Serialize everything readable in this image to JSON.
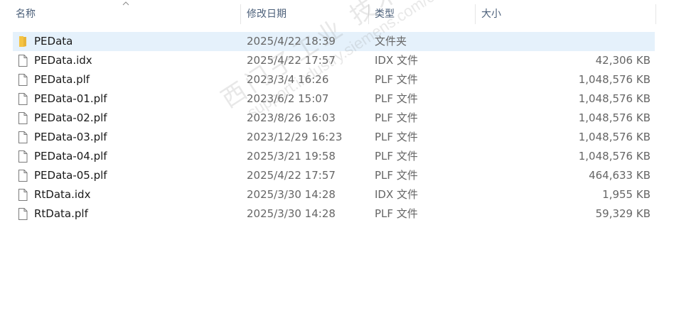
{
  "columns": {
    "name": "名称",
    "date": "修改日期",
    "type": "类型",
    "size": "大小"
  },
  "files": [
    {
      "icon": "folder-icon",
      "name": "PEData",
      "date": "2025/4/22 18:39",
      "type": "文件夹",
      "size": "",
      "selected": true
    },
    {
      "icon": "file-icon",
      "name": "PEData.idx",
      "date": "2025/4/22 17:57",
      "type": "IDX 文件",
      "size": "42,306 KB"
    },
    {
      "icon": "file-icon",
      "name": "PEData.plf",
      "date": "2023/3/4 16:26",
      "type": "PLF 文件",
      "size": "1,048,576 KB"
    },
    {
      "icon": "file-icon",
      "name": "PEData-01.plf",
      "date": "2023/6/2 15:07",
      "type": "PLF 文件",
      "size": "1,048,576 KB"
    },
    {
      "icon": "file-icon",
      "name": "PEData-02.plf",
      "date": "2023/8/26 16:03",
      "type": "PLF 文件",
      "size": "1,048,576 KB"
    },
    {
      "icon": "file-icon",
      "name": "PEData-03.plf",
      "date": "2023/12/29 16:23",
      "type": "PLF 文件",
      "size": "1,048,576 KB"
    },
    {
      "icon": "file-icon",
      "name": "PEData-04.plf",
      "date": "2025/3/21 19:58",
      "type": "PLF 文件",
      "size": "1,048,576 KB"
    },
    {
      "icon": "file-icon",
      "name": "PEData-05.plf",
      "date": "2025/4/22 17:57",
      "type": "PLF 文件",
      "size": "464,633 KB"
    },
    {
      "icon": "file-icon",
      "name": "RtData.idx",
      "date": "2025/3/30 14:28",
      "type": "IDX 文件",
      "size": "1,955 KB"
    },
    {
      "icon": "file-icon",
      "name": "RtData.plf",
      "date": "2025/3/30 14:28",
      "type": "PLF 文件",
      "size": "59,329 KB"
    }
  ],
  "watermark": {
    "line1": "西门子工业 技术论坛",
    "line2": "support.industry.siemens.com/cs"
  },
  "colors": {
    "selection": "#e5f1fb",
    "header_text": "#4c607a",
    "folder": "#f5c342"
  }
}
